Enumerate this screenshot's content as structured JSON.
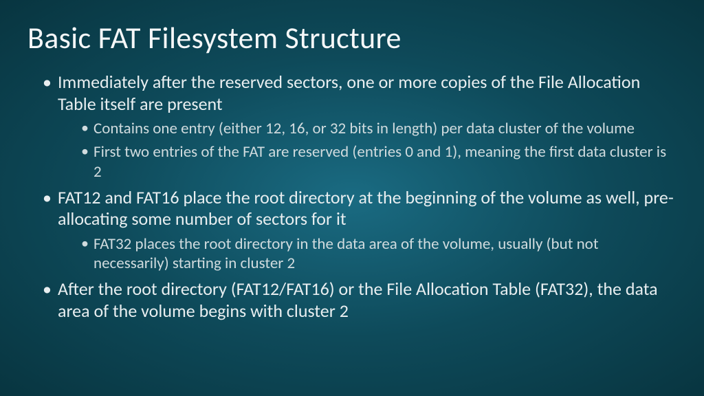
{
  "slide": {
    "title": "Basic FAT Filesystem Structure",
    "bullets": [
      {
        "text": "Immediately after the reserved sectors, one or more copies of the File Allocation Table itself are present",
        "children": [
          {
            "text": "Contains one entry (either 12, 16, or 32 bits in length) per data cluster of the volume"
          },
          {
            "text": "First two entries of the FAT are reserved (entries 0 and 1), meaning the first data cluster is 2"
          }
        ]
      },
      {
        "text": "FAT12 and FAT16 place the root directory at the beginning of the volume as well, pre-allocating some number of sectors for it",
        "children": [
          {
            "text": "FAT32 places the root directory in the data area of the volume, usually (but not necessarily) starting in cluster 2"
          }
        ]
      },
      {
        "text": "After the root directory (FAT12/FAT16) or the File Allocation Table (FAT32), the data area of the volume begins with cluster 2",
        "children": []
      }
    ]
  }
}
